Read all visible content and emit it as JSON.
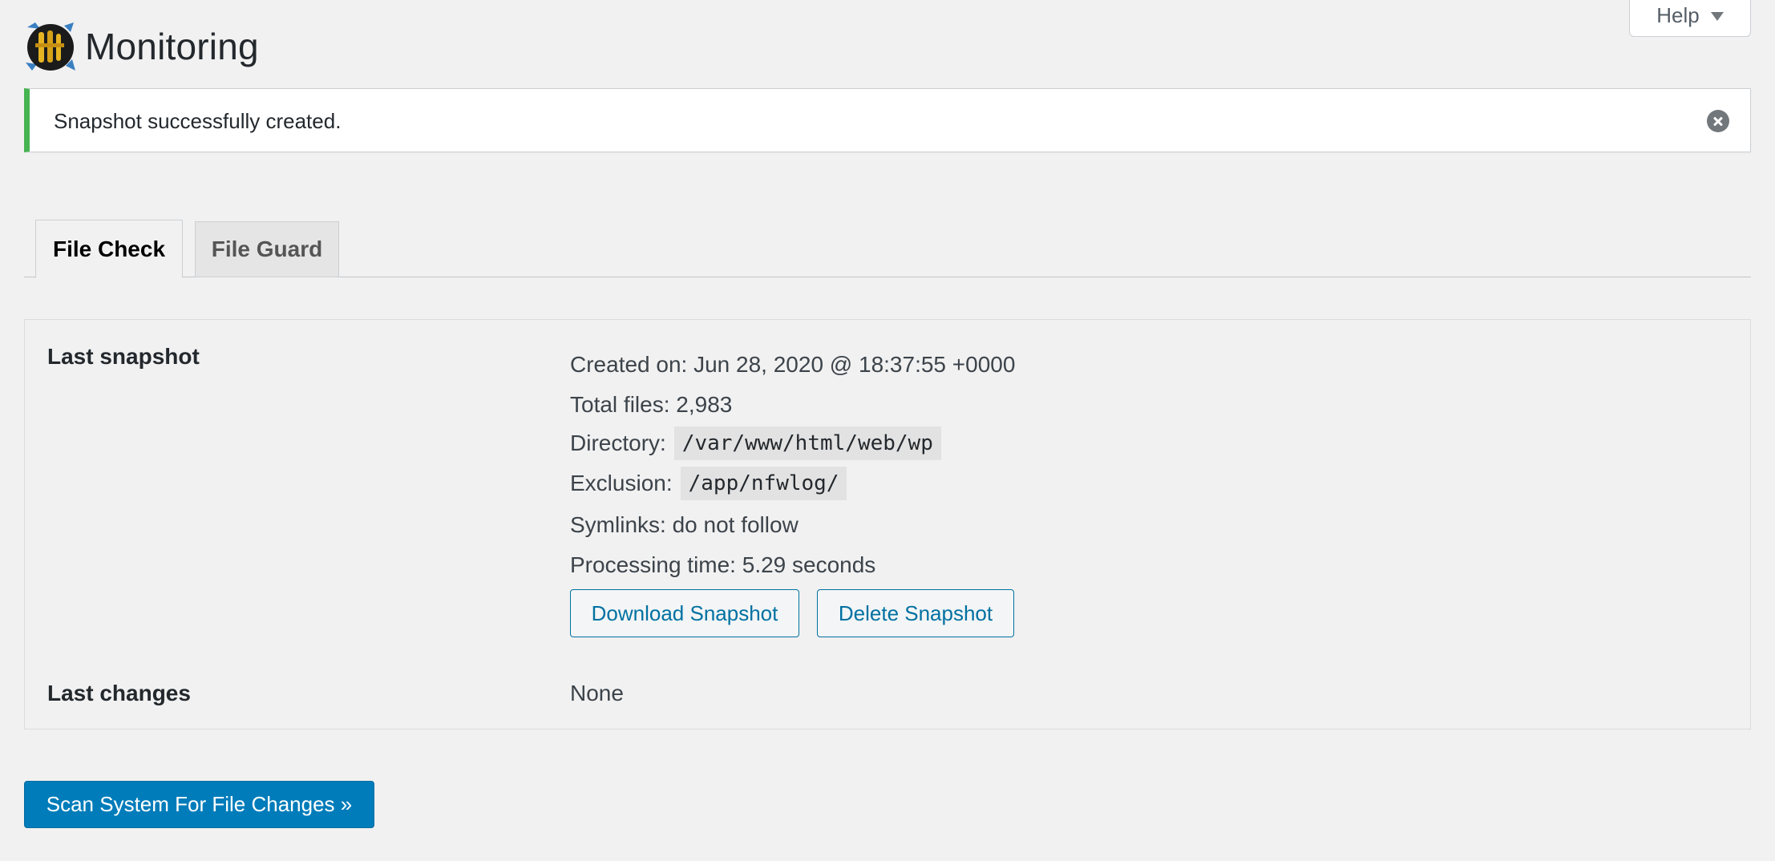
{
  "help_tab": {
    "label": "Help"
  },
  "header": {
    "title": "Monitoring"
  },
  "notice": {
    "message": "Snapshot successfully created."
  },
  "tabs": [
    {
      "label": "File Check",
      "active": true
    },
    {
      "label": "File Guard",
      "active": false
    }
  ],
  "snapshot": {
    "section_label": "Last snapshot",
    "created_on": "Created on: Jun 28, 2020 @ 18:37:55 +0000",
    "total_files": "Total files: 2,983",
    "directory_label": "Directory:",
    "directory_value": "/var/www/html/web/wp",
    "exclusion_label": "Exclusion:",
    "exclusion_value": "/app/nfwlog/",
    "symlinks": "Symlinks: do not follow",
    "processing_time": "Processing time: 5.29 seconds",
    "download_label": "Download Snapshot",
    "delete_label": "Delete Snapshot"
  },
  "changes": {
    "section_label": "Last changes",
    "value": "None"
  },
  "scan_button": {
    "label": "Scan System For File Changes »"
  },
  "colors": {
    "success": "#46b450",
    "primary": "#007cba",
    "link": "#0071a1",
    "background": "#f1f1f1"
  }
}
